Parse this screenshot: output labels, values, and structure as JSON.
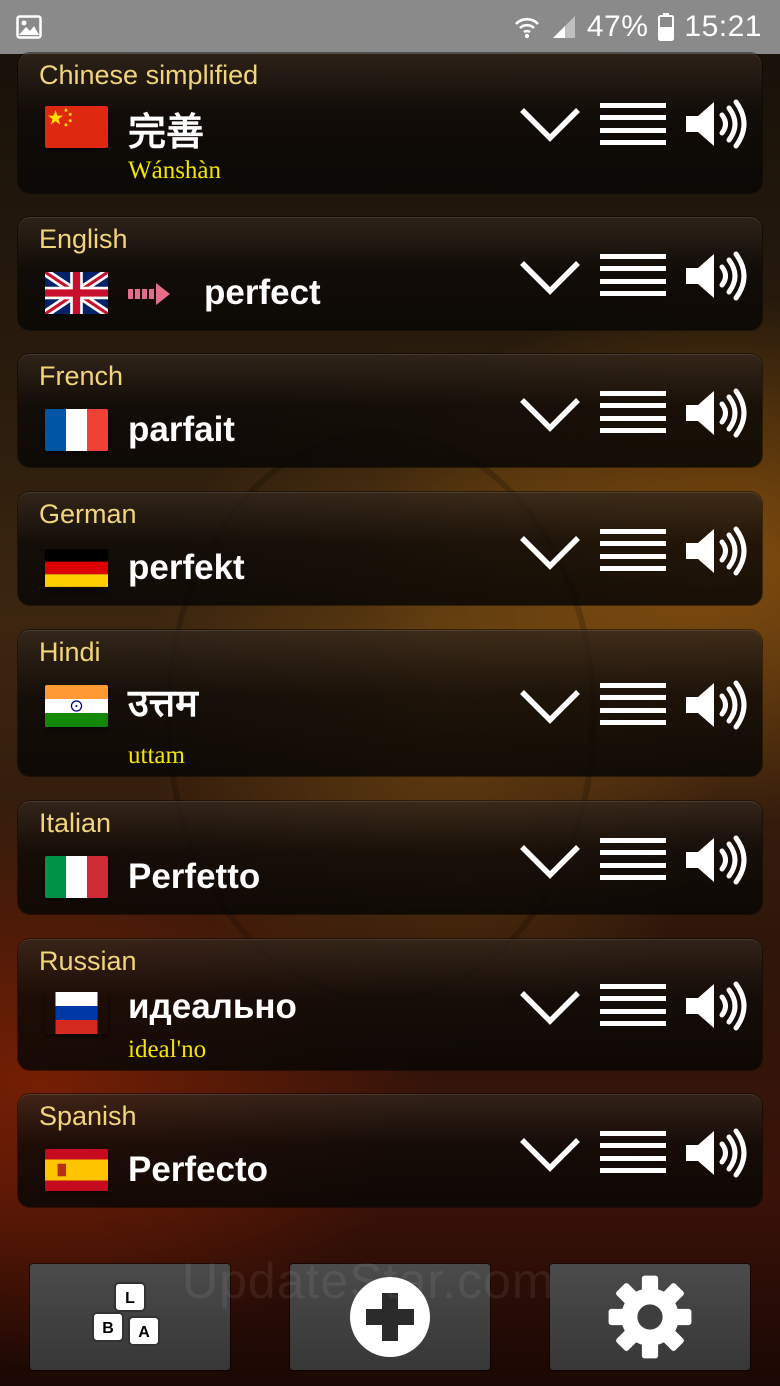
{
  "status_bar": {
    "battery": "47%",
    "time": "15:21",
    "icons": [
      "image-icon",
      "wifi-icon",
      "signal-icon",
      "battery-icon"
    ]
  },
  "languages": [
    {
      "name": "Chinese simplified",
      "word": "完善",
      "translit": "Wánshàn",
      "flag": "china-flag"
    },
    {
      "name": "English",
      "word": "perfect",
      "translit": "",
      "flag": "uk-flag",
      "source": true
    },
    {
      "name": "French",
      "word": "parfait",
      "translit": "",
      "flag": "france-flag"
    },
    {
      "name": "German",
      "word": "perfekt",
      "translit": "",
      "flag": "germany-flag"
    },
    {
      "name": "Hindi",
      "word": "उत्तम",
      "translit": "uttam",
      "flag": "india-flag"
    },
    {
      "name": "Italian",
      "word": "Perfetto",
      "translit": "",
      "flag": "italy-flag"
    },
    {
      "name": "Russian",
      "word": "идеально",
      "translit": "ideal'no",
      "flag": "russia-flag"
    },
    {
      "name": "Spanish",
      "word": "Perfecto",
      "translit": "",
      "flag": "spain-flag"
    }
  ],
  "row_controls": [
    "chevron-down-icon",
    "menu-icon",
    "speaker-icon"
  ],
  "toolbar": {
    "keyboard_keys": [
      "L",
      "B",
      "A"
    ],
    "buttons": [
      "keyboard-icon",
      "plus-icon",
      "gear-icon"
    ]
  },
  "watermark": "UpdateStar.com",
  "colors": {
    "lang_name": "#f2d57a",
    "translit": "#f4e600",
    "word": "#ffffff",
    "source_arrow": "#e56c8a",
    "status_bar": "#8a8a8a"
  }
}
